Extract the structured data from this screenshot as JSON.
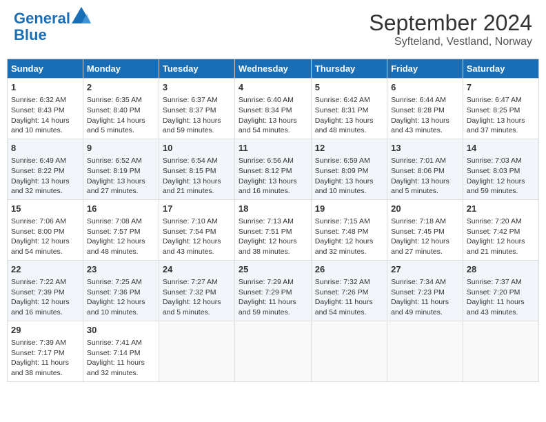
{
  "header": {
    "logo_line1": "General",
    "logo_line2": "Blue",
    "month": "September 2024",
    "location": "Syfteland, Vestland, Norway"
  },
  "days_of_week": [
    "Sunday",
    "Monday",
    "Tuesday",
    "Wednesday",
    "Thursday",
    "Friday",
    "Saturday"
  ],
  "weeks": [
    [
      {
        "day": 1,
        "info": "Sunrise: 6:32 AM\nSunset: 8:43 PM\nDaylight: 14 hours\nand 10 minutes."
      },
      {
        "day": 2,
        "info": "Sunrise: 6:35 AM\nSunset: 8:40 PM\nDaylight: 14 hours\nand 5 minutes."
      },
      {
        "day": 3,
        "info": "Sunrise: 6:37 AM\nSunset: 8:37 PM\nDaylight: 13 hours\nand 59 minutes."
      },
      {
        "day": 4,
        "info": "Sunrise: 6:40 AM\nSunset: 8:34 PM\nDaylight: 13 hours\nand 54 minutes."
      },
      {
        "day": 5,
        "info": "Sunrise: 6:42 AM\nSunset: 8:31 PM\nDaylight: 13 hours\nand 48 minutes."
      },
      {
        "day": 6,
        "info": "Sunrise: 6:44 AM\nSunset: 8:28 PM\nDaylight: 13 hours\nand 43 minutes."
      },
      {
        "day": 7,
        "info": "Sunrise: 6:47 AM\nSunset: 8:25 PM\nDaylight: 13 hours\nand 37 minutes."
      }
    ],
    [
      {
        "day": 8,
        "info": "Sunrise: 6:49 AM\nSunset: 8:22 PM\nDaylight: 13 hours\nand 32 minutes."
      },
      {
        "day": 9,
        "info": "Sunrise: 6:52 AM\nSunset: 8:19 PM\nDaylight: 13 hours\nand 27 minutes."
      },
      {
        "day": 10,
        "info": "Sunrise: 6:54 AM\nSunset: 8:15 PM\nDaylight: 13 hours\nand 21 minutes."
      },
      {
        "day": 11,
        "info": "Sunrise: 6:56 AM\nSunset: 8:12 PM\nDaylight: 13 hours\nand 16 minutes."
      },
      {
        "day": 12,
        "info": "Sunrise: 6:59 AM\nSunset: 8:09 PM\nDaylight: 13 hours\nand 10 minutes."
      },
      {
        "day": 13,
        "info": "Sunrise: 7:01 AM\nSunset: 8:06 PM\nDaylight: 13 hours\nand 5 minutes."
      },
      {
        "day": 14,
        "info": "Sunrise: 7:03 AM\nSunset: 8:03 PM\nDaylight: 12 hours\nand 59 minutes."
      }
    ],
    [
      {
        "day": 15,
        "info": "Sunrise: 7:06 AM\nSunset: 8:00 PM\nDaylight: 12 hours\nand 54 minutes."
      },
      {
        "day": 16,
        "info": "Sunrise: 7:08 AM\nSunset: 7:57 PM\nDaylight: 12 hours\nand 48 minutes."
      },
      {
        "day": 17,
        "info": "Sunrise: 7:10 AM\nSunset: 7:54 PM\nDaylight: 12 hours\nand 43 minutes."
      },
      {
        "day": 18,
        "info": "Sunrise: 7:13 AM\nSunset: 7:51 PM\nDaylight: 12 hours\nand 38 minutes."
      },
      {
        "day": 19,
        "info": "Sunrise: 7:15 AM\nSunset: 7:48 PM\nDaylight: 12 hours\nand 32 minutes."
      },
      {
        "day": 20,
        "info": "Sunrise: 7:18 AM\nSunset: 7:45 PM\nDaylight: 12 hours\nand 27 minutes."
      },
      {
        "day": 21,
        "info": "Sunrise: 7:20 AM\nSunset: 7:42 PM\nDaylight: 12 hours\nand 21 minutes."
      }
    ],
    [
      {
        "day": 22,
        "info": "Sunrise: 7:22 AM\nSunset: 7:39 PM\nDaylight: 12 hours\nand 16 minutes."
      },
      {
        "day": 23,
        "info": "Sunrise: 7:25 AM\nSunset: 7:36 PM\nDaylight: 12 hours\nand 10 minutes."
      },
      {
        "day": 24,
        "info": "Sunrise: 7:27 AM\nSunset: 7:32 PM\nDaylight: 12 hours\nand 5 minutes."
      },
      {
        "day": 25,
        "info": "Sunrise: 7:29 AM\nSunset: 7:29 PM\nDaylight: 11 hours\nand 59 minutes."
      },
      {
        "day": 26,
        "info": "Sunrise: 7:32 AM\nSunset: 7:26 PM\nDaylight: 11 hours\nand 54 minutes."
      },
      {
        "day": 27,
        "info": "Sunrise: 7:34 AM\nSunset: 7:23 PM\nDaylight: 11 hours\nand 49 minutes."
      },
      {
        "day": 28,
        "info": "Sunrise: 7:37 AM\nSunset: 7:20 PM\nDaylight: 11 hours\nand 43 minutes."
      }
    ],
    [
      {
        "day": 29,
        "info": "Sunrise: 7:39 AM\nSunset: 7:17 PM\nDaylight: 11 hours\nand 38 minutes."
      },
      {
        "day": 30,
        "info": "Sunrise: 7:41 AM\nSunset: 7:14 PM\nDaylight: 11 hours\nand 32 minutes."
      },
      null,
      null,
      null,
      null,
      null
    ]
  ]
}
